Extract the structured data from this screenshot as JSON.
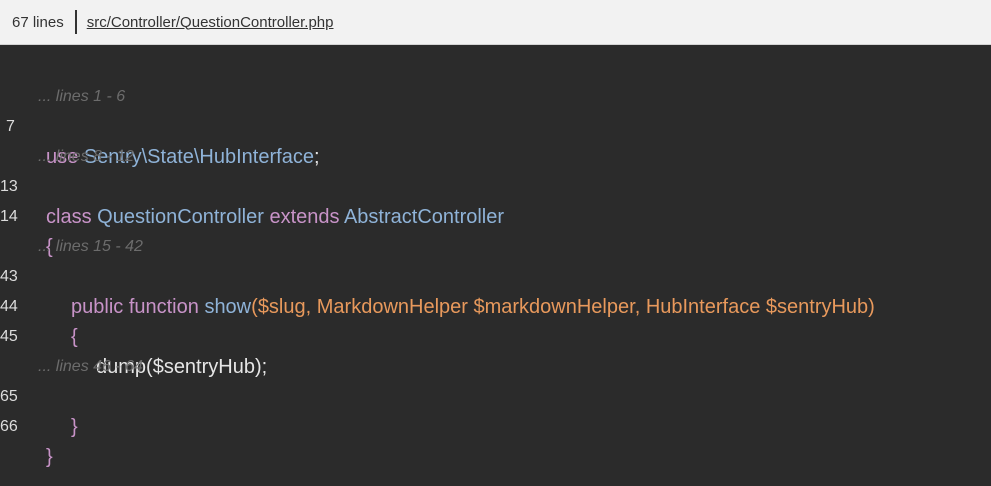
{
  "header": {
    "line_count": "67 lines",
    "file_path": "src/Controller/QuestionController.php"
  },
  "code": {
    "fold_1": "... lines 1 - 6",
    "ln_7": "7",
    "l7": {
      "kw": "use",
      "ns": "Sentry\\State\\HubInterface",
      "semi": ";"
    },
    "fold_2": "... lines 8 - 12",
    "ln_13": "13",
    "l13": {
      "kw1": "class",
      "name": "QuestionController",
      "kw2": "extends",
      "parent": "AbstractController"
    },
    "ln_14": "14",
    "l14": {
      "brace": "{"
    },
    "fold_3": "... lines 15 - 42",
    "ln_43": "43",
    "l43": {
      "kw": "public function",
      "fn": "show",
      "open": "(",
      "p1": "$slug",
      "comma1": ", ",
      "t2": "MarkdownHelper",
      "p2": "$markdownHelper",
      "comma2": ", ",
      "t3": "HubInterface",
      "p3": "$sentryHub",
      "close": ")"
    },
    "ln_44": "44",
    "l44": {
      "brace": "{"
    },
    "ln_45": "45",
    "l45": {
      "text": "dump($sentryHub);"
    },
    "fold_4": "... lines 46 - 64",
    "ln_65": "65",
    "l65": {
      "brace": "}"
    },
    "ln_66": "66",
    "l66": {
      "brace": "}"
    }
  }
}
